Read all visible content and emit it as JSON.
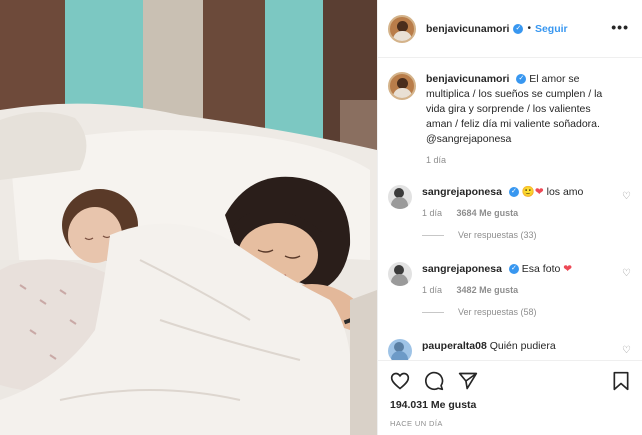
{
  "post": {
    "username": "benjavicunamori",
    "follow_label": "Seguir",
    "separator": "•",
    "more_label": "•••"
  },
  "caption": {
    "username": "benjavicunamori",
    "text": "El amor se multiplica / los sueños se cumplen / la vida gira y sorprende / los valientes aman / feliz día mi valiente soñadora. @sangrejaponesa",
    "age": "1 día"
  },
  "comments": [
    {
      "username": "sangrejaponesa",
      "text": "🙂❤ los amo",
      "age": "1 día",
      "likes": "3684 Me gusta",
      "replies": "Ver respuestas (33)"
    },
    {
      "username": "sangrejaponesa",
      "text": "Esa foto ❤",
      "age": "1 día",
      "likes": "3482 Me gusta",
      "replies": "Ver respuestas (58)"
    },
    {
      "username": "pauperalta08",
      "text": "Quién pudiera"
    }
  ],
  "footer": {
    "likes": "194.031 Me gusta",
    "time_ago": "HACE UN DÍA"
  },
  "icons": {
    "verified": "verified-badge-icon",
    "like": "heart-icon",
    "comment": "comment-bubble-icon",
    "share": "paper-plane-icon",
    "save": "bookmark-icon",
    "comment_like": "small-heart-icon"
  },
  "colors": {
    "link_blue": "#3897f0",
    "heart_red": "#ed4956",
    "muted_text": "#8e8e8e",
    "wall_teal": "#7cc8c2",
    "wall_brown": "#6b4a3a"
  }
}
